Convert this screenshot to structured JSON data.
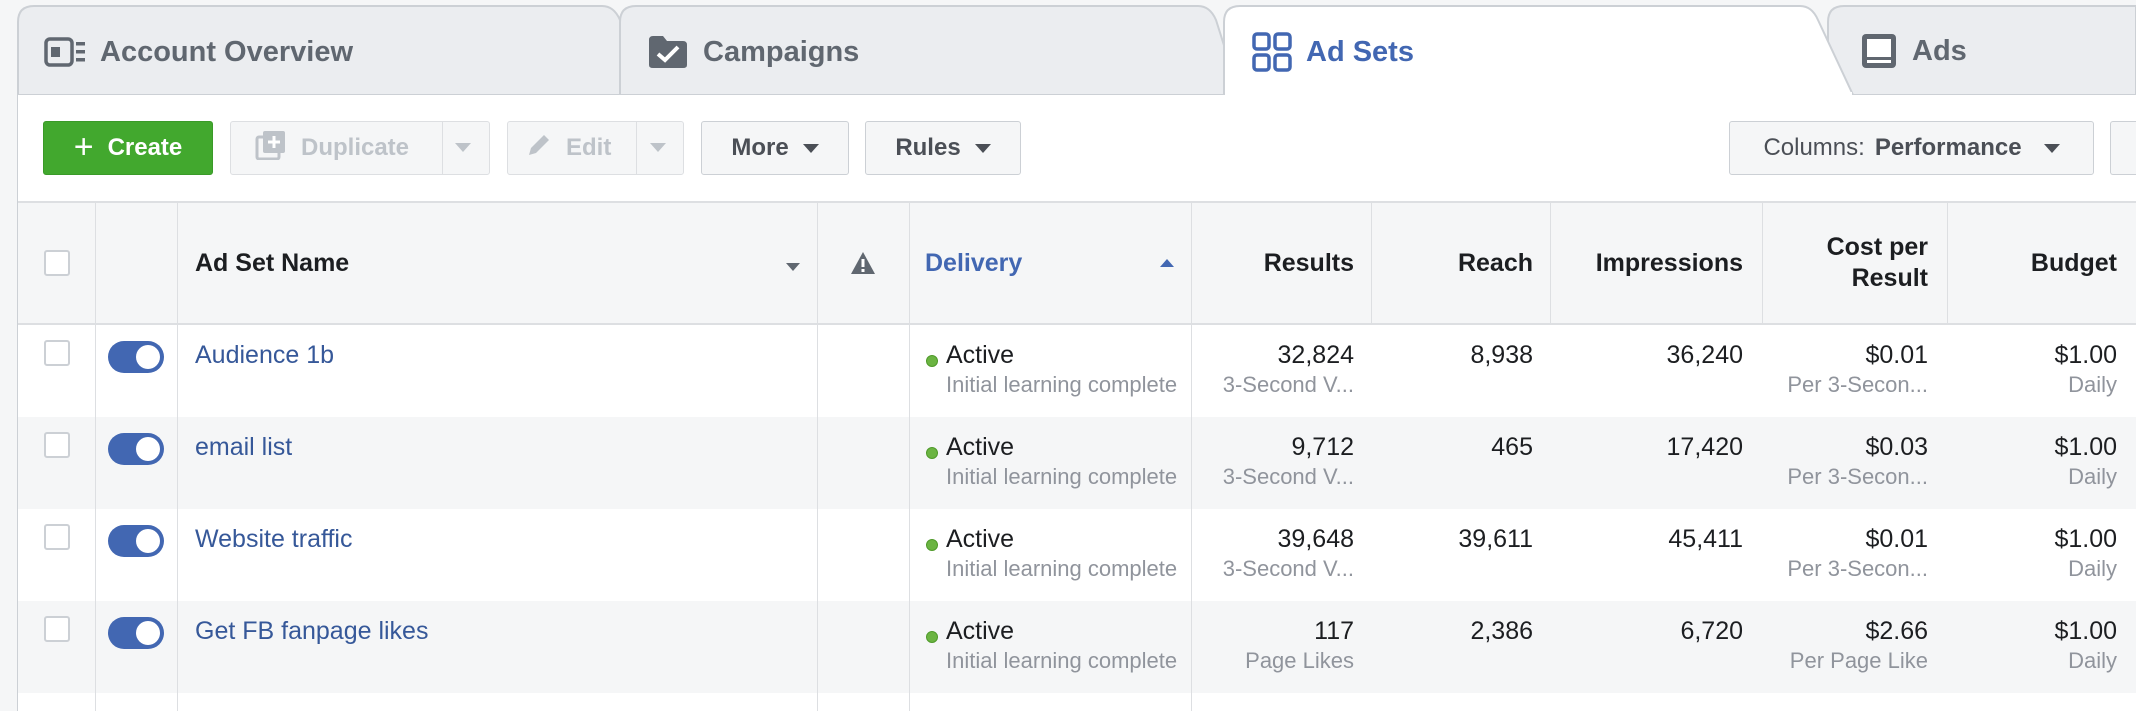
{
  "tabs": [
    {
      "label": "Account Overview",
      "icon": "account-overview-icon",
      "active": false
    },
    {
      "label": "Campaigns",
      "icon": "folder-check-icon",
      "active": false
    },
    {
      "label": "Ad Sets",
      "icon": "grid-icon",
      "active": true
    },
    {
      "label": "Ads",
      "icon": "ad-icon",
      "active": false
    }
  ],
  "toolbar": {
    "create_label": "Create",
    "duplicate_label": "Duplicate",
    "edit_label": "Edit",
    "more_label": "More",
    "rules_label": "Rules",
    "columns_prefix": "Columns:",
    "columns_value": "Performance"
  },
  "table": {
    "headers": {
      "name": "Ad Set Name",
      "delivery": "Delivery",
      "results": "Results",
      "reach": "Reach",
      "impressions": "Impressions",
      "cost_line1": "Cost per",
      "cost_line2": "Result",
      "budget": "Budget"
    },
    "rows": [
      {
        "name": "Audience 1b",
        "status": "Active",
        "status_sub": "Initial learning complete",
        "results": "32,824",
        "results_sub": "3-Second V...",
        "reach": "8,938",
        "impressions": "36,240",
        "cost": "$0.01",
        "cost_sub": "Per 3-Secon...",
        "budget": "$1.00",
        "budget_sub": "Daily"
      },
      {
        "name": "email list",
        "status": "Active",
        "status_sub": "Initial learning complete",
        "results": "9,712",
        "results_sub": "3-Second V...",
        "reach": "465",
        "impressions": "17,420",
        "cost": "$0.03",
        "cost_sub": "Per 3-Secon...",
        "budget": "$1.00",
        "budget_sub": "Daily"
      },
      {
        "name": "Website traffic",
        "status": "Active",
        "status_sub": "Initial learning complete",
        "results": "39,648",
        "results_sub": "3-Second V...",
        "reach": "39,611",
        "impressions": "45,411",
        "cost": "$0.01",
        "cost_sub": "Per 3-Secon...",
        "budget": "$1.00",
        "budget_sub": "Daily"
      },
      {
        "name": "Get FB fanpage likes",
        "status": "Active",
        "status_sub": "Initial learning complete",
        "results": "117",
        "results_sub": "Page Likes",
        "reach": "2,386",
        "impressions": "6,720",
        "cost": "$2.66",
        "cost_sub": "Per Page Like",
        "budget": "$1.00",
        "budget_sub": "Daily"
      }
    ]
  },
  "colors": {
    "accent": "#4267b2",
    "create_green": "#42a82e",
    "active_dot": "#6bb442"
  }
}
